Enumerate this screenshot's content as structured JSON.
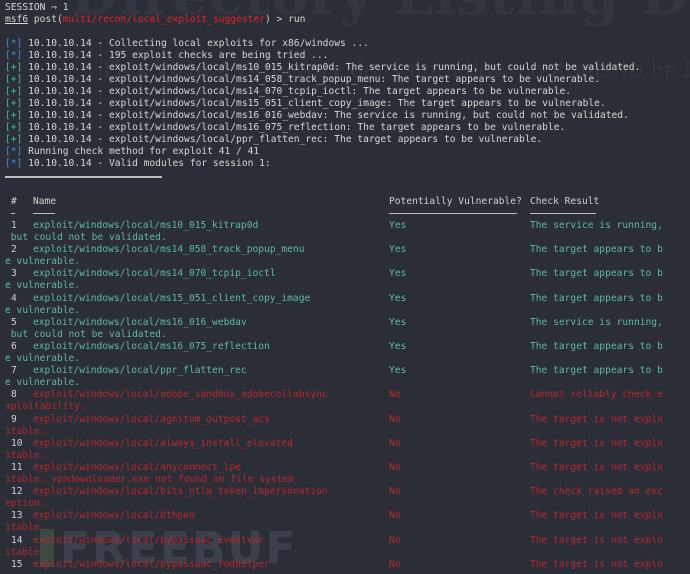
{
  "watermark": {
    "title": "Directory Listing Denied",
    "subtitle": "This Virtual Directory does not allow contents to be listed.",
    "brand": "FREEBUF"
  },
  "terminal": {
    "session_line": "SESSION ⇒ 1",
    "prompt": {
      "prefix": "msf6",
      "module_type": "post",
      "module_path": "multi/recon/local_exploit_suggester",
      "command": "run"
    },
    "log": [
      {
        "tag": "[*]",
        "kind": "info",
        "text": "10.10.10.14 - Collecting local exploits for x86/windows ..."
      },
      {
        "tag": "[*]",
        "kind": "info",
        "text": "10.10.10.14 - 195 exploit checks are being tried ..."
      },
      {
        "tag": "[+]",
        "kind": "good",
        "text": "10.10.10.14 - exploit/windows/local/ms10_015_kitrap0d: The service is running, but could not be validated."
      },
      {
        "tag": "[+]",
        "kind": "good",
        "text": "10.10.10.14 - exploit/windows/local/ms14_058_track_popup_menu: The target appears to be vulnerable."
      },
      {
        "tag": "[+]",
        "kind": "good",
        "text": "10.10.10.14 - exploit/windows/local/ms14_070_tcpip_ioctl: The target appears to be vulnerable."
      },
      {
        "tag": "[+]",
        "kind": "good",
        "text": "10.10.10.14 - exploit/windows/local/ms15_051_client_copy_image: The target appears to be vulnerable."
      },
      {
        "tag": "[+]",
        "kind": "good",
        "text": "10.10.10.14 - exploit/windows/local/ms16_016_webdav: The service is running, but could not be validated."
      },
      {
        "tag": "[+]",
        "kind": "good",
        "text": "10.10.10.14 - exploit/windows/local/ms16_075_reflection: The target appears to be vulnerable."
      },
      {
        "tag": "[+]",
        "kind": "good",
        "text": "10.10.10.14 - exploit/windows/local/ppr_flatten_rec: The target appears to be vulnerable."
      },
      {
        "tag": "[*]",
        "kind": "info",
        "text": "Running check method for exploit 41 / 41"
      },
      {
        "tag": "[*]",
        "kind": "info",
        "text": "10.10.10.14 - Valid modules for session 1:"
      }
    ],
    "table": {
      "headers": {
        "num": "#",
        "name": "Name",
        "vuln": "Potentially Vulnerable?",
        "result": "Check Result"
      },
      "rows": [
        {
          "num": "1",
          "name": "exploit/windows/local/ms10_015_kitrap0d",
          "vuln": "Yes",
          "result": "The service is running,",
          "wrap": " but could not be validated.",
          "ok": true
        },
        {
          "num": "2",
          "name": "exploit/windows/local/ms14_058_track_popup_menu",
          "vuln": "Yes",
          "result": "The target appears to b",
          "wrap": "e vulnerable.",
          "ok": true
        },
        {
          "num": "3",
          "name": "exploit/windows/local/ms14_070_tcpip_ioctl",
          "vuln": "Yes",
          "result": "The target appears to b",
          "wrap": "e vulnerable.",
          "ok": true
        },
        {
          "num": "4",
          "name": "exploit/windows/local/ms15_051_client_copy_image",
          "vuln": "Yes",
          "result": "The target appears to b",
          "wrap": "e vulnerable.",
          "ok": true
        },
        {
          "num": "5",
          "name": "exploit/windows/local/ms16_016_webdav",
          "vuln": "Yes",
          "result": "The service is running,",
          "wrap": " but could not be validated.",
          "ok": true
        },
        {
          "num": "6",
          "name": "exploit/windows/local/ms16_075_reflection",
          "vuln": "Yes",
          "result": "The target appears to b",
          "wrap": "e vulnerable.",
          "ok": true
        },
        {
          "num": "7",
          "name": "exploit/windows/local/ppr_flatten_rec",
          "vuln": "Yes",
          "result": "The target appears to b",
          "wrap": "e vulnerable.",
          "ok": true
        },
        {
          "num": "8",
          "name": "exploit/windows/local/adobe_sandbox_adobecollabsync",
          "vuln": "No",
          "result": "Cannot reliably check e",
          "wrap": "xploitability.",
          "ok": false
        },
        {
          "num": "9",
          "name": "exploit/windows/local/agnitum_outpost_acs",
          "vuln": "No",
          "result": "The target is not explo",
          "wrap": "itable.",
          "ok": false
        },
        {
          "num": "10",
          "name": "exploit/windows/local/always_install_elevated",
          "vuln": "No",
          "result": "The target is not explo",
          "wrap": "itable.",
          "ok": false
        },
        {
          "num": "11",
          "name": "exploit/windows/local/anyconnect_lpe",
          "vuln": "No",
          "result": "The target is not explo",
          "wrap": "itable. vpndownloader.exe not found on file system",
          "ok": false
        },
        {
          "num": "12",
          "name": "exploit/windows/local/bits_ntlm_token_impersonation",
          "vuln": "No",
          "result": "The check raised an exc",
          "wrap": "eption.",
          "ok": false
        },
        {
          "num": "13",
          "name": "exploit/windows/local/bthpan",
          "vuln": "No",
          "result": "The target is not explo",
          "wrap": "itable.",
          "ok": false
        },
        {
          "num": "14",
          "name": "exploit/windows/local/bypassuac_eventvwr",
          "vuln": "No",
          "result": "The target is not explo",
          "wrap": "itable.",
          "ok": false
        },
        {
          "num": "15",
          "name": "exploit/windows/local/bypassuac_fodhelper",
          "vuln": "No",
          "result": "The target is not explo",
          "wrap": "",
          "ok": false
        }
      ]
    }
  }
}
